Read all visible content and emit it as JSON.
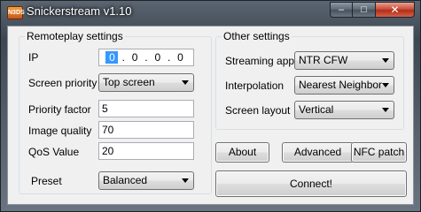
{
  "window": {
    "title": "Snickerstream v1.10",
    "icon_text": "N3DS",
    "minimize": "–",
    "maximize": "□",
    "close": "✕"
  },
  "remoteplay": {
    "title": "Remoteplay settings",
    "ip_label": "IP",
    "ip": [
      "0",
      "0",
      "0",
      "0"
    ],
    "ip_dot": ".",
    "screen_priority_label": "Screen priority",
    "screen_priority_value": "Top screen",
    "priority_factor_label": "Priority factor",
    "priority_factor_value": "5",
    "image_quality_label": "Image quality",
    "image_quality_value": "70",
    "qos_label": "QoS Value",
    "qos_value": "20",
    "preset_label": "Preset",
    "preset_value": "Balanced"
  },
  "other": {
    "title": "Other settings",
    "streaming_app_label": "Streaming app",
    "streaming_app_value": "NTR CFW",
    "interpolation_label": "Interpolation",
    "interpolation_value": "Nearest Neighbor",
    "screen_layout_label": "Screen layout",
    "screen_layout_value": "Vertical"
  },
  "buttons": {
    "about": "About",
    "advanced": "Advanced",
    "nfc_patch": "NFC patch",
    "connect": "Connect!"
  }
}
